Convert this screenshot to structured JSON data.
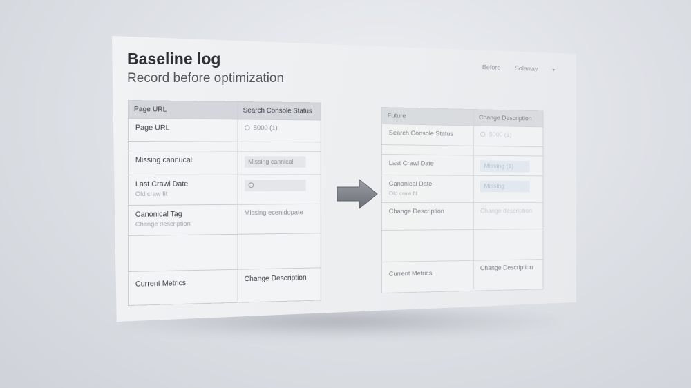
{
  "header": {
    "title": "Baseline log",
    "subtitle": "Record before optimization",
    "menu_before": "Before",
    "menu_solarray": "Solarray"
  },
  "left_table": {
    "columns": [
      "Page URL",
      "Search Console Status"
    ],
    "rows": [
      {
        "label": "Page URL",
        "value": "5000 (1)"
      },
      {
        "label": "",
        "value": ""
      },
      {
        "label": "Missing cannucal",
        "value": "Missing cannical"
      },
      {
        "label": "Last Crawl Date",
        "sub": "Old craw fit",
        "value": ""
      },
      {
        "label": "Canonical Tag",
        "sub": "Change description",
        "value": "Missing ecenldopate"
      },
      {
        "label": "",
        "value": ""
      },
      {
        "label": "Current Metrics",
        "value": "Change Description"
      }
    ]
  },
  "right_table": {
    "columns": [
      "Future",
      "Change Description"
    ],
    "rows": [
      {
        "label": "Search Console Status",
        "value": "5000 (1)"
      },
      {
        "label": "",
        "value": ""
      },
      {
        "label": "Last Crawl Date",
        "value": "Missing (1)"
      },
      {
        "label": "Canonical Date",
        "sub": "Old craw fit",
        "value": "Missing"
      },
      {
        "label": "Change Description",
        "value": "Change description"
      },
      {
        "label": "",
        "value": ""
      },
      {
        "label": "Current Metrics",
        "value": "Change Description"
      }
    ]
  },
  "icons": {
    "info": "info-circle-icon",
    "arrow": "right-arrow-icon",
    "caret": "chevron-down-icon"
  },
  "colors": {
    "panel": "#eceef0",
    "header_row": "#d3d6da",
    "arrow": "#7d8187"
  }
}
